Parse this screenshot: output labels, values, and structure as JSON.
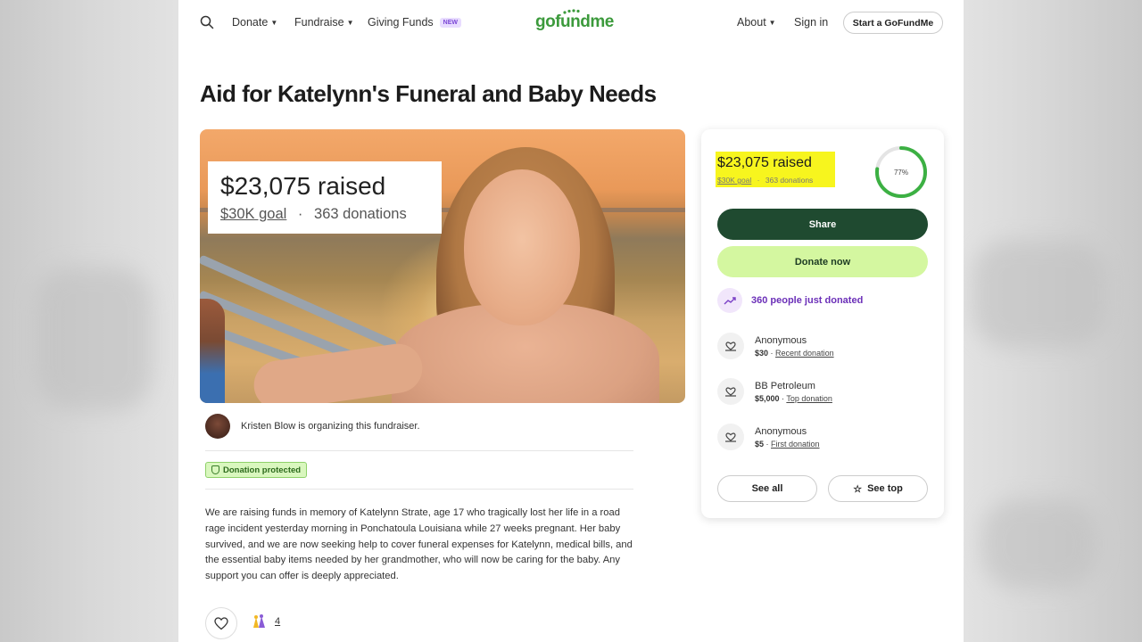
{
  "nav": {
    "donate": "Donate",
    "fundraise": "Fundraise",
    "giving_funds": "Giving Funds",
    "new_badge": "NEW",
    "logo": "gofundme",
    "about": "About",
    "sign_in": "Sign in",
    "start": "Start a GoFundMe"
  },
  "campaign": {
    "title": "Aid for Katelynn's Funeral and Baby Needs",
    "raised": "$23,075 raised",
    "goal": "$30K goal",
    "separator": "·",
    "donations": "363 donations",
    "organizer_text": "Kristen Blow is organizing this fundraiser.",
    "protected_label": "Donation protected",
    "story": "We are raising funds in memory of Katelynn Strate, age 17 who tragically lost her life in a road rage incident yesterday morning in Ponchatoula Louisiana while 27 weeks pregnant. Her baby survived, and we are now seeking help to cover funeral expenses for Katelynn, medical bills, and the essential baby items needed by her grandmother, who will now be caring for the baby. Any support you can offer is deeply appreciated.",
    "reaction_count": "4"
  },
  "sidebar": {
    "raised": "$23,075 raised",
    "goal": "$30K goal",
    "donations": "363 donations",
    "progress_label": "77%",
    "progress_fraction": 0.77,
    "share": "Share",
    "donate_now": "Donate now",
    "trend_text": "360 people just donated",
    "donations_list": [
      {
        "name": "Anonymous",
        "amount": "$30",
        "tag": "Recent donation"
      },
      {
        "name": "BB Petroleum",
        "amount": "$5,000",
        "tag": "Top donation"
      },
      {
        "name": "Anonymous",
        "amount": "$5",
        "tag": "First donation"
      }
    ],
    "see_all": "See all",
    "see_top": "See top"
  },
  "colors": {
    "brand_green": "#3c9a3c",
    "share_button": "#1f4a30",
    "donate_button": "#d4f7a0",
    "trend_purple": "#6b2fb8",
    "highlight": "#f7f51e",
    "progress_ring": "#3cb043"
  },
  "icons": [
    "search-icon",
    "chevron-down-icon",
    "heart-icon",
    "trend-up-icon",
    "donor-heart-hand-icon",
    "star-icon",
    "shield-icon",
    "clapping-hands-icon"
  ]
}
